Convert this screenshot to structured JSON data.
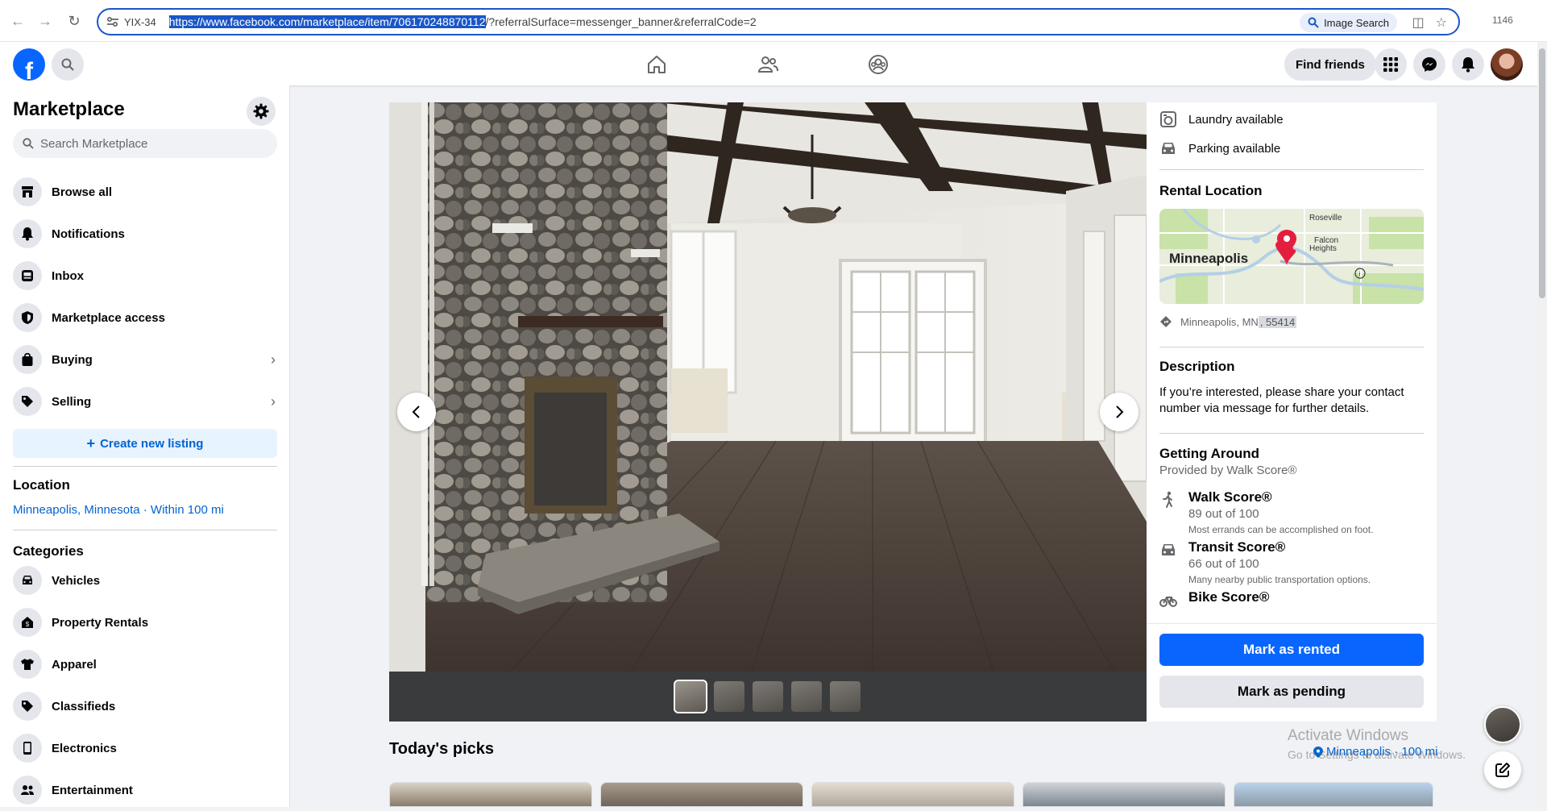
{
  "browser": {
    "site_chip": "YIX-34",
    "url_selected": "https://www.facebook.com/marketplace/item/706170248870112",
    "url_rest": "/?referralSurface=messenger_banner&referralCode=2",
    "image_search_label": "Image Search",
    "tab_count": "1146"
  },
  "topnav": {
    "logo_letter": "f",
    "find_friends_label": "Find friends"
  },
  "sidebar": {
    "title": "Marketplace",
    "search_placeholder": "Search Marketplace",
    "items": [
      {
        "label": "Browse all",
        "icon": "storefront-icon"
      },
      {
        "label": "Notifications",
        "icon": "bell-icon"
      },
      {
        "label": "Inbox",
        "icon": "inbox-icon"
      },
      {
        "label": "Marketplace access",
        "icon": "shield-icon"
      },
      {
        "label": "Buying",
        "icon": "shopping-bag-icon"
      },
      {
        "label": "Selling",
        "icon": "price-tag-icon"
      }
    ],
    "create_listing_label": "Create new listing",
    "location_heading": "Location",
    "location_value": "Minneapolis, Minnesota · Within 100 mi",
    "categories_heading": "Categories",
    "categories": [
      {
        "label": "Vehicles",
        "icon": "car-icon"
      },
      {
        "label": "Property Rentals",
        "icon": "house-icon"
      },
      {
        "label": "Apparel",
        "icon": "shirt-icon"
      },
      {
        "label": "Classifieds",
        "icon": "tag-icon"
      },
      {
        "label": "Electronics",
        "icon": "phone-icon"
      },
      {
        "label": "Entertainment",
        "icon": "people-icon"
      }
    ]
  },
  "details": {
    "amenities": [
      "Laundry available",
      "Parking available"
    ],
    "rental_location_title": "Rental Location",
    "map_labels": {
      "city": "Minneapolis",
      "roseville": "Roseville",
      "falcon": "Falcon",
      "heights": "Heights"
    },
    "address_city": "Minneapolis, MN",
    "address_zip": ", 55414",
    "description_title": "Description",
    "description_text": "If you’re interested, please share your contact number via message for further details.",
    "getting_around_title": "Getting Around",
    "provided_by": "Provided by Walk Score®",
    "scores": [
      {
        "name": "Walk Score®",
        "value": "89 out of 100",
        "note": "Most errands can be accomplished on foot."
      },
      {
        "name": "Transit Score®",
        "value": "66 out of 100",
        "note": "Many nearby public transportation options."
      },
      {
        "name": "Bike Score®",
        "value": "",
        "note": ""
      }
    ],
    "mark_rented_label": "Mark as rented",
    "mark_pending_label": "Mark as pending"
  },
  "picks": {
    "title": "Today's picks",
    "location": "Minneapolis · 100 mi"
  },
  "watermark": {
    "line1": "Activate Windows",
    "line2": "Go to Settings to activate Windows."
  },
  "colors": {
    "fb_blue": "#0866ff",
    "link_blue": "#0064d1",
    "background": "#f0f2f5"
  }
}
